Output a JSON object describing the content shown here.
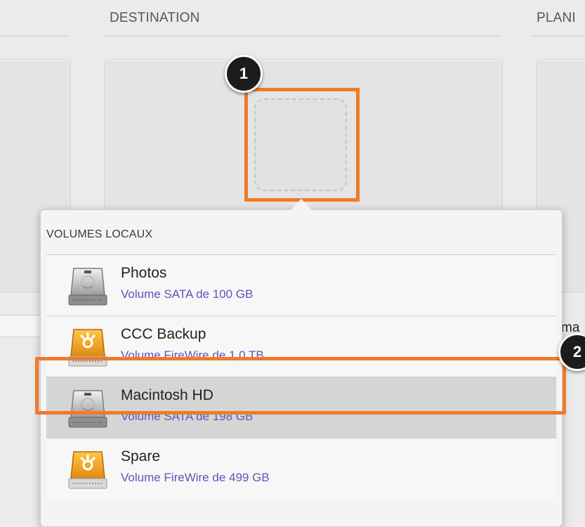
{
  "header": {
    "source": "",
    "destination": "DESTINATION",
    "schedule": "PLANI"
  },
  "right_partial_text": "ma",
  "callouts": [
    "1",
    "2"
  ],
  "colors": {
    "callout": "#f07a2a",
    "volume_desc": "#5b56b6",
    "selected_row": "#d5d5d5"
  },
  "popover": {
    "section_title": "VOLUMES LOCAUX",
    "volumes": [
      {
        "name": "Photos",
        "description": "Volume SATA de 100 GB",
        "icon": "internal-hard-drive-icon",
        "selected": false
      },
      {
        "name": "CCC Backup",
        "description": "Volume FireWire de 1,0 TB",
        "icon": "firewire-drive-icon",
        "selected": false
      },
      {
        "name": "Macintosh HD",
        "description": "Volume SATA de 198 GB",
        "icon": "internal-hard-drive-icon",
        "selected": true
      },
      {
        "name": "Spare",
        "description": "Volume FireWire de 499 GB",
        "icon": "firewire-drive-icon",
        "selected": false
      }
    ]
  }
}
